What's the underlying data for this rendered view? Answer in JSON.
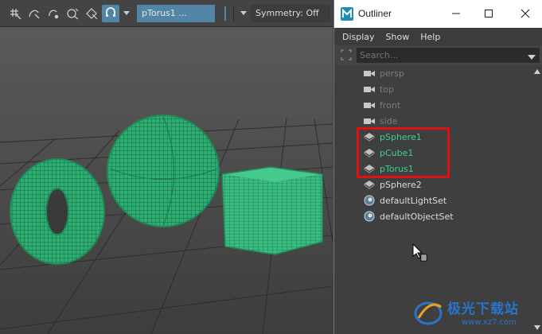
{
  "viewport": {
    "toolbar": {
      "object_field": "pTorus1 ...",
      "symmetry": "Symmetry: Off"
    }
  },
  "outliner": {
    "title": "Outliner",
    "menu": [
      "Display",
      "Show",
      "Help"
    ],
    "search": {
      "placeholder": "Search..."
    },
    "items": [
      {
        "label": "persp",
        "icon": "camera-icon",
        "kind": "camera"
      },
      {
        "label": "top",
        "icon": "camera-icon",
        "kind": "camera"
      },
      {
        "label": "front",
        "icon": "camera-icon",
        "kind": "camera"
      },
      {
        "label": "side",
        "icon": "camera-icon",
        "kind": "camera"
      },
      {
        "label": "pSphere1",
        "icon": "mesh-icon",
        "kind": "selected"
      },
      {
        "label": "pCube1",
        "icon": "mesh-icon",
        "kind": "selected"
      },
      {
        "label": "pTorus1",
        "icon": "mesh-icon",
        "kind": "selected"
      },
      {
        "label": "pSphere2",
        "icon": "mesh-icon",
        "kind": "normal"
      },
      {
        "label": "defaultLightSet",
        "icon": "set-icon",
        "kind": "normal"
      },
      {
        "label": "defaultObjectSet",
        "icon": "set-icon",
        "kind": "normal"
      }
    ]
  },
  "watermark": {
    "text": "极光下载站",
    "url": "www.xz7.com"
  },
  "colors": {
    "selection": "#3fd08a",
    "highlight_box": "#e01010",
    "accent": "#5285a6"
  }
}
